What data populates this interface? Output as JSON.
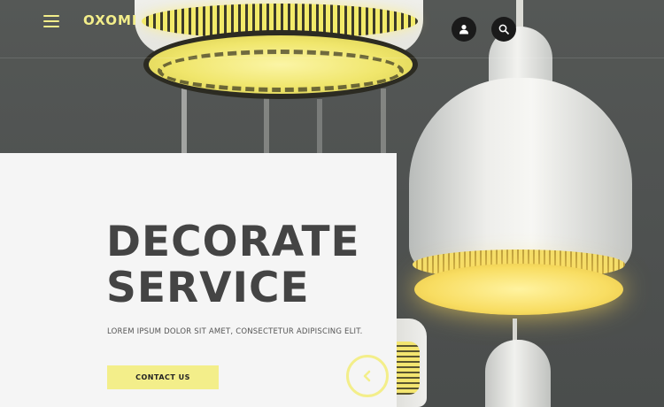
{
  "header": {
    "logo": "OXOMI",
    "menu_icon": "hamburger-menu-icon",
    "user_icon": "user-icon",
    "search_icon": "search-icon"
  },
  "hero": {
    "title_line1": "DECORATE",
    "title_line2": "SERVICE",
    "description": "LOREM IPSUM DOLOR SIT AMET, CONSECTETUR ADIPISCING ELIT.",
    "cta_label": "CONTACT US",
    "prev_icon": "chevron-left-icon"
  },
  "colors": {
    "accent": "#f3ee8a",
    "panel_bg": "#f5f5f5",
    "title_text": "#444444",
    "icon_bg": "#1a1a1a"
  }
}
